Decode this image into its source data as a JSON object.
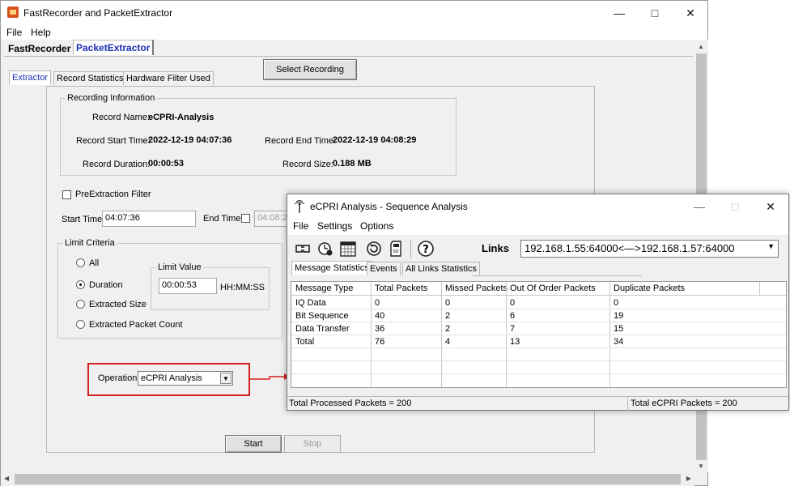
{
  "main": {
    "title": "FastRecorder and PacketExtractor",
    "menu": [
      "File",
      "Help"
    ],
    "top_tabs": [
      "FastRecorder",
      "PacketExtractor"
    ],
    "sub_tabs": [
      "Extractor",
      "Record Statistics",
      "Hardware Filter Used"
    ],
    "select_recording": "Select Recording",
    "recording_info": {
      "title": "Recording Information",
      "name_label": "Record Name:",
      "name_value": "eCPRI-Analysis",
      "start_label": "Record Start Time:",
      "start_value": "2022-12-19 04:07:36",
      "end_label": "Record End Time:",
      "end_value": "2022-12-19 04:08:29",
      "duration_label": "Record Duration:",
      "duration_value": "00:00:53",
      "size_label": "Record Size:",
      "size_value": "0.188 MB"
    },
    "pre_filter": "PreExtraction Filter",
    "start_time_label": "Start Time",
    "start_time_value": "04:07:36",
    "end_time_label": "End Time",
    "end_time_value": "04:08:2",
    "limit": {
      "title": "Limit Criteria",
      "options": [
        "All",
        "Duration",
        "Extracted Size",
        "Extracted Packet Count"
      ],
      "value_title": "Limit Value",
      "value": "00:00:53",
      "unit": "HH:MM:SS"
    },
    "operation_label": "Operation",
    "operation_value": "eCPRI Analysis",
    "start_btn": "Start",
    "stop_btn": "Stop"
  },
  "seq": {
    "title": "eCPRI Analysis - Sequence Analysis",
    "menu": [
      "File",
      "Settings",
      "Options"
    ],
    "links_label": "Links",
    "links_value": "192.168.1.55:64000<—>192.168.1.57:64000",
    "tabs": [
      "Message Statistics",
      "Events",
      "All Links Statistics"
    ],
    "columns": [
      "Message Type",
      "Total Packets",
      "Missed Packets",
      "Out Of Order Packets",
      "Duplicate Packets"
    ],
    "rows": [
      [
        "IQ Data",
        "0",
        "0",
        "0",
        "0"
      ],
      [
        "Bit Sequence",
        "40",
        "2",
        "6",
        "19"
      ],
      [
        "Data Transfer",
        "36",
        "2",
        "7",
        "15"
      ],
      [
        "Total",
        "76",
        "4",
        "13",
        "34"
      ]
    ],
    "status_left": "Total Processed Packets = 200",
    "status_right": "Total eCPRI Packets = 200"
  },
  "colors": {
    "accent_red": "#d42020",
    "tab_blue": "#1a2fb3"
  },
  "icons": [
    "app-icon",
    "minimize-icon",
    "maximize-icon",
    "close-icon",
    "antenna-icon"
  ]
}
